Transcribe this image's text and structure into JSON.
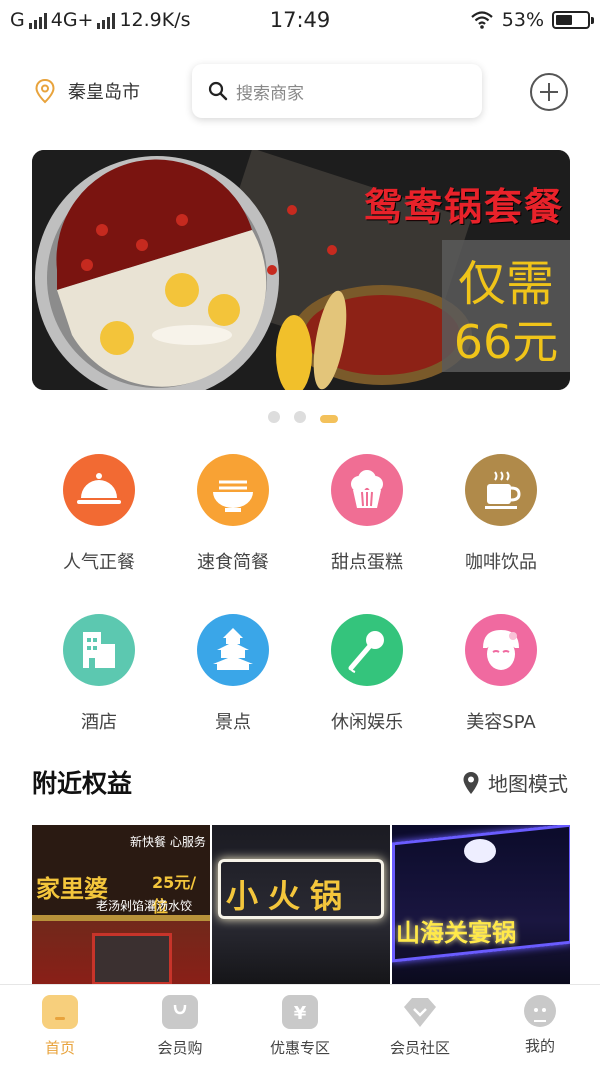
{
  "status_bar": {
    "carrier": "G",
    "network": "4G+",
    "speed": "12.9K/s",
    "time": "17:49",
    "battery": "53%",
    "battery_level": 0.53
  },
  "header": {
    "city": "秦皇岛市",
    "search_placeholder": "搜索商家",
    "icons": {
      "location": "location-pin-icon",
      "search": "search-icon",
      "add": "plus-circle-icon"
    }
  },
  "banner": {
    "title": "鸳鸯锅套餐",
    "price_line1": "仅需",
    "price_line2": "66元",
    "page_count": 3,
    "active_page": 2
  },
  "categories": [
    {
      "label": "人气正餐",
      "icon": "cloche-icon",
      "color": "#f26a33"
    },
    {
      "label": "速食简餐",
      "icon": "noodle-bowl-icon",
      "color": "#f8a234"
    },
    {
      "label": "甜点蛋糕",
      "icon": "cupcake-icon",
      "color": "#f06e94"
    },
    {
      "label": "咖啡饮品",
      "icon": "coffee-cup-icon",
      "color": "#b08a4a"
    },
    {
      "label": "酒店",
      "icon": "hotel-building-icon",
      "color": "#5cc8b0"
    },
    {
      "label": "景点",
      "icon": "pagoda-icon",
      "color": "#3aa6e8"
    },
    {
      "label": "休闲娱乐",
      "icon": "microphone-icon",
      "color": "#34c47c"
    },
    {
      "label": "美容SPA",
      "icon": "spa-face-icon",
      "color": "#f06aa0"
    }
  ],
  "nearby": {
    "title": "附近权益",
    "map_mode": "地图模式",
    "shops": [
      {
        "name": "家里婆",
        "sign": "老汤剁馅灌汤水饺",
        "price": "25元/位",
        "extra": "新快餐 心服务"
      },
      {
        "name": "小火锅"
      },
      {
        "name": "山海关宴锅"
      }
    ]
  },
  "bottom_nav": [
    {
      "label": "首页",
      "icon": "home-icon",
      "active": true
    },
    {
      "label": "会员购",
      "icon": "shopping-bag-icon",
      "active": false
    },
    {
      "label": "优惠专区",
      "icon": "coupon-icon",
      "active": false
    },
    {
      "label": "会员社区",
      "icon": "diamond-icon",
      "active": false
    },
    {
      "label": "我的",
      "icon": "profile-icon",
      "active": false
    }
  ],
  "colors": {
    "accent": "#f3c15b",
    "nav_active": "#e8a33c",
    "banner_title": "#e8222a",
    "banner_price": "#f0c419"
  }
}
